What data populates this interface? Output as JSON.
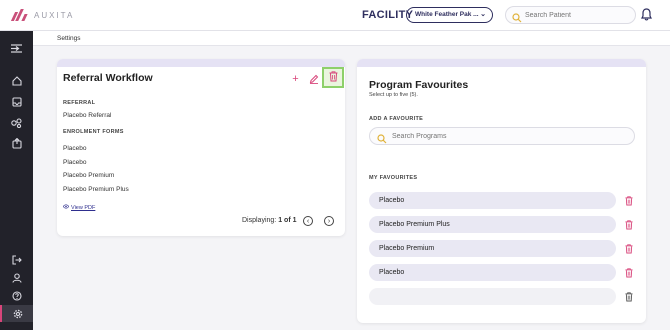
{
  "header": {
    "logo_text": "AUXITA",
    "facility_label": "FACILITY",
    "facility_value": "White Feather Pak ...",
    "patient_search_placeholder": "Search Patient"
  },
  "breadcrumb": {
    "current": "Settings"
  },
  "sidebar": {
    "items": [
      {
        "name": "menu-toggle-icon"
      },
      {
        "name": "home-icon"
      },
      {
        "name": "inbox-icon"
      },
      {
        "name": "referrals-icon"
      },
      {
        "name": "export-icon"
      },
      {
        "name": "logout-icon"
      },
      {
        "name": "user-icon"
      },
      {
        "name": "help-icon"
      },
      {
        "name": "settings-icon",
        "active": true
      }
    ]
  },
  "referral_workflow": {
    "title": "Referral Workflow",
    "referral_label": "REFERRAL",
    "referral_value": "Placebo Referral",
    "enrolment_label": "ENROLMENT FORMS",
    "enrolment_forms": [
      "Placebo",
      "Placebo",
      "Placebo Premium",
      "Placebo Premium Plus"
    ],
    "view_pdf": "View PDF",
    "displaying_label": "Displaying:",
    "displaying_value": "1 of 1"
  },
  "program_favourites": {
    "title": "Program Favourites",
    "subtitle": "Select up to five (5).",
    "add_label": "ADD A FAVOURITE",
    "search_placeholder": "Search Programs",
    "favourites_label": "MY FAVOURITES",
    "favourites": [
      "Placebo",
      "Placebo Premium Plus",
      "Placebo Premium",
      "Placebo",
      ""
    ]
  },
  "colors": {
    "accent": "#d8457a",
    "navy": "#2e2e5e",
    "sidebar": "#22222a",
    "highlight": "#8ed06a"
  }
}
